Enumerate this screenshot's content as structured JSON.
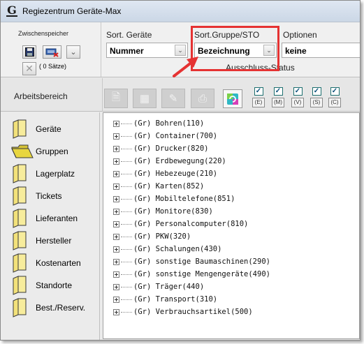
{
  "window": {
    "title": "Regiezentrum Geräte-Max",
    "logo": "G"
  },
  "clipboard": {
    "label": "Zwischenspeicher",
    "count": "( 0 Sätze)",
    "buttons": [
      "save-icon",
      "keyboard-delete-icon",
      "chevron-down-icon",
      "close-x-icon"
    ]
  },
  "sort_devices": {
    "label": "Sort. Geräte",
    "value": "Nummer"
  },
  "sort_group": {
    "label": "Sort.Gruppe/STO",
    "value": "Bezeichnung"
  },
  "options": {
    "label": "Optionen",
    "value": "keine"
  },
  "exclusion_label": "Ausschluss-Status",
  "workarea": {
    "label": "Arbeitsbereich",
    "toolbar_icons": [
      "new-document-icon",
      "table-icon",
      "edit-table-icon",
      "print-icon",
      "refresh-icon"
    ],
    "status_filters": [
      {
        "code": "(E)",
        "checked": true
      },
      {
        "code": "(M)",
        "checked": true
      },
      {
        "code": "(V)",
        "checked": true
      },
      {
        "code": "(S)",
        "checked": true
      },
      {
        "code": "(C)",
        "checked": true
      }
    ]
  },
  "nav": {
    "selected": "Gruppen",
    "items": [
      {
        "label": "Geräte"
      },
      {
        "label": "Gruppen"
      },
      {
        "label": "Lagerplatz"
      },
      {
        "label": "Tickets"
      },
      {
        "label": "Lieferanten"
      },
      {
        "label": "Hersteller"
      },
      {
        "label": "Kostenarten"
      },
      {
        "label": "Standorte"
      },
      {
        "label": "Best./Reserv."
      }
    ]
  },
  "tree": {
    "items": [
      "(Gr) Bohren(110)",
      "(Gr) Container(700)",
      "(Gr) Drucker(820)",
      "(Gr) Erdbewegung(220)",
      "(Gr) Hebezeuge(210)",
      "(Gr) Karten(852)",
      "(Gr) Mobiltelefone(851)",
      "(Gr) Monitore(830)",
      "(Gr) Personalcomputer(810)",
      "(Gr) PKW(320)",
      "(Gr) Schalungen(430)",
      "(Gr) sonstige Baumaschinen(290)",
      "(Gr) sonstige Mengengeräte(490)",
      "(Gr) Träger(440)",
      "(Gr) Transport(310)",
      "(Gr) Verbrauchsartikel(500)"
    ]
  },
  "colors": {
    "highlight": "#e53232",
    "folder": "#f3e27a",
    "folder_selected": "#e8d640",
    "checkbox": "#0b4f7a"
  }
}
